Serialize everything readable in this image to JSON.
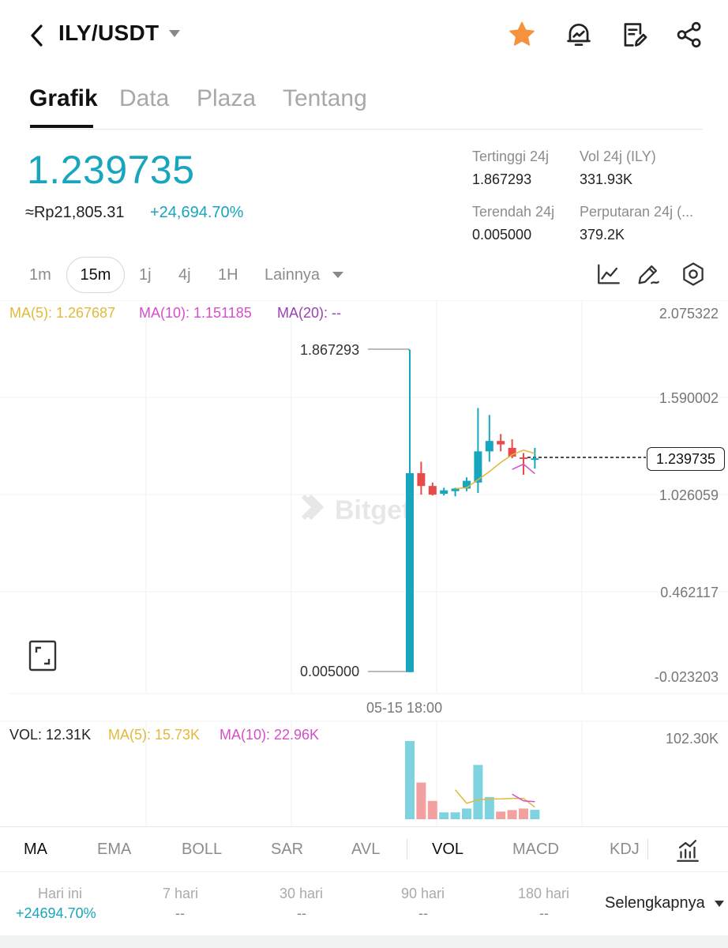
{
  "header": {
    "pair": "ILY/USDT",
    "icons": [
      "back-icon",
      "star-icon",
      "price-alert-icon",
      "notes-icon",
      "share-icon"
    ],
    "star_color": "#f5923e"
  },
  "tabs": [
    {
      "label": "Grafik",
      "active": true
    },
    {
      "label": "Data",
      "active": false
    },
    {
      "label": "Plaza",
      "active": false
    },
    {
      "label": "Tentang",
      "active": false
    }
  ],
  "price": {
    "last": "1.239735",
    "idr": "≈Rp21,805.31",
    "change": "+24,694.70%",
    "color": "#17a6bd"
  },
  "stats": {
    "high_label": "Tertinggi 24j",
    "high_value": "1.867293",
    "vol_label": "Vol 24j (ILY)",
    "vol_value": "331.93K",
    "low_label": "Terendah 24j",
    "low_value": "0.005000",
    "turnover_label": "Perputaran 24j (...",
    "turnover_value": "379.2K"
  },
  "timeframes": {
    "items": [
      "1m",
      "15m",
      "1j",
      "4j",
      "1H"
    ],
    "active": "15m",
    "more": "Lainnya",
    "tools": [
      "line-chart-icon",
      "draw-tool-icon",
      "settings-icon"
    ]
  },
  "ma_legend": {
    "ma5": "MA(5): 1.267687",
    "ma10": "MA(10): 1.151185",
    "ma20": "MA(20): --",
    "ma5_color": "#e2b93b",
    "ma10_color": "#d54fc8",
    "ma20_color": "#9b3fb5"
  },
  "y_axis": [
    "2.075322",
    "1.590002",
    "1.026059",
    "0.462117",
    "-0.023203"
  ],
  "last_price_tag": "1.239735",
  "high_marker": "1.867293",
  "low_marker": "0.005000",
  "x_axis_label": "05-15 18:00",
  "watermark": "Bitget",
  "chart_data": {
    "type": "candlestick",
    "ylim": [
      -0.023203,
      2.075322
    ],
    "up_color": "#17a6bd",
    "down_color": "#e84a4a",
    "candles": [
      {
        "o": 0.005,
        "h": 1.8673,
        "l": 0.005,
        "c": 1.154
      },
      {
        "o": 1.154,
        "h": 1.22,
        "l": 1.03,
        "c": 1.08
      },
      {
        "o": 1.08,
        "h": 1.1,
        "l": 1.025,
        "c": 1.03
      },
      {
        "o": 1.035,
        "h": 1.07,
        "l": 1.025,
        "c": 1.055
      },
      {
        "o": 1.05,
        "h": 1.07,
        "l": 1.02,
        "c": 1.065
      },
      {
        "o": 1.065,
        "h": 1.13,
        "l": 1.05,
        "c": 1.11
      },
      {
        "o": 1.1,
        "h": 1.53,
        "l": 1.04,
        "c": 1.28
      },
      {
        "o": 1.28,
        "h": 1.49,
        "l": 1.22,
        "c": 1.34
      },
      {
        "o": 1.34,
        "h": 1.38,
        "l": 1.28,
        "c": 1.32
      },
      {
        "o": 1.3,
        "h": 1.35,
        "l": 1.24,
        "c": 1.25
      },
      {
        "o": 1.245,
        "h": 1.27,
        "l": 1.145,
        "c": 1.24
      },
      {
        "o": 1.235,
        "h": 1.3,
        "l": 1.18,
        "c": 1.2397
      }
    ],
    "ma5": [
      null,
      null,
      null,
      null,
      1.065,
      1.07,
      1.116,
      1.163,
      1.216,
      1.26,
      1.287,
      1.2677
    ],
    "ma10": [
      null,
      null,
      null,
      null,
      null,
      null,
      null,
      null,
      null,
      1.176,
      1.206,
      1.1512
    ],
    "volume": {
      "values": [
        102.3,
        48.0,
        24.0,
        9.0,
        9.0,
        14.0,
        71.0,
        29.0,
        10.0,
        12.0,
        14.0,
        12.31
      ],
      "ylim": [
        0,
        102.3
      ],
      "axis_max_label": "102.30K",
      "ma5": [
        null,
        null,
        null,
        null,
        38.5,
        20.8,
        25.4,
        26.4,
        26.6,
        27.2,
        27.2,
        15.73
      ],
      "ma10": [
        null,
        null,
        null,
        null,
        null,
        null,
        null,
        null,
        null,
        32.8,
        24.0,
        22.96
      ]
    }
  },
  "vol_legend": {
    "vol": "VOL: 12.31K",
    "ma5": "MA(5): 15.73K",
    "ma10": "MA(10): 22.96K"
  },
  "indicators": {
    "items": [
      "MA",
      "EMA",
      "BOLL",
      "SAR",
      "AVL",
      "VOL",
      "MACD",
      "KDJ"
    ],
    "active": [
      "MA",
      "VOL"
    ],
    "settings_icon": "indicator-settings-icon"
  },
  "performance": {
    "items": [
      {
        "label": "Hari ini",
        "value": "+24694.70%"
      },
      {
        "label": "7 hari",
        "value": "--"
      },
      {
        "label": "30 hari",
        "value": "--"
      },
      {
        "label": "90 hari",
        "value": "--"
      },
      {
        "label": "180 hari",
        "value": "--"
      }
    ],
    "more": "Selengkapnya"
  }
}
